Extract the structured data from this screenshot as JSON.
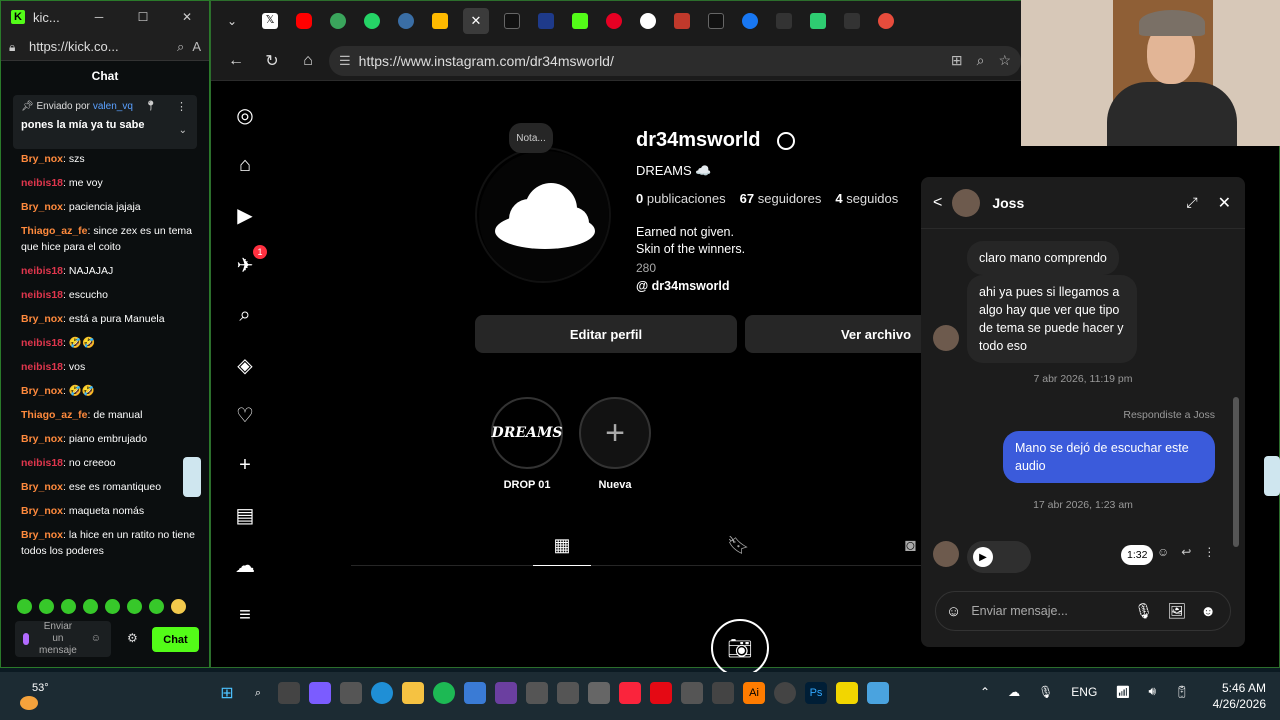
{
  "kick": {
    "title": "kic...",
    "url": "https://kick.co...",
    "chat_header": "Chat",
    "pinned": {
      "label": "Enviado por",
      "user": "valen_vq",
      "message": "pones la mía ya tu sabe"
    },
    "messages": [
      {
        "user": "Bry_nox",
        "text": ": szs",
        "color": "orange"
      },
      {
        "user": "neibis18",
        "text": ": me voy",
        "color": "red"
      },
      {
        "user": "Bry_nox",
        "text": ": paciencia jajaja",
        "color": "orange"
      },
      {
        "user": "Thiago_az_fe",
        "text": ": since zex es un tema que hice para el coito",
        "color": "orange"
      },
      {
        "user": "neibis18",
        "text": ": NAJAJAJ",
        "color": "red"
      },
      {
        "user": "neibis18",
        "text": ": escucho",
        "color": "red"
      },
      {
        "user": "Bry_nox",
        "text": ": está a pura Manuela",
        "color": "orange"
      },
      {
        "user": "neibis18",
        "text": ": 🤣🤣",
        "color": "red"
      },
      {
        "user": "neibis18",
        "text": ": vos",
        "color": "red"
      },
      {
        "user": "Bry_nox",
        "text": ": 🤣🤣",
        "color": "orange"
      },
      {
        "user": "Thiago_az_fe",
        "text": ": de manual",
        "color": "orange"
      },
      {
        "user": "Bry_nox",
        "text": ": piano embrujado",
        "color": "orange"
      },
      {
        "user": "neibis18",
        "text": ": no creeoo",
        "color": "red"
      },
      {
        "user": "Bry_nox",
        "text": ": ese es romantiqueo",
        "color": "orange"
      },
      {
        "user": "Bry_nox",
        "text": ": maqueta nomás",
        "color": "orange"
      },
      {
        "user": "Bry_nox",
        "text": ": la hice en un ratito no tiene todos los poderes",
        "color": "orange"
      }
    ],
    "input_placeholder": "Enviar un mensaje",
    "send_label": "Chat"
  },
  "browser": {
    "url": "https://www.instagram.com/dr34msworld/"
  },
  "profile": {
    "note": "Nota...",
    "username": "dr34msworld",
    "full_name": "DREAMS ☁️",
    "posts_count": "0",
    "posts_label": "publicaciones",
    "followers_count": "67",
    "followers_label": "seguidores",
    "following_count": "4",
    "following_label": "seguidos",
    "bio_line1": "Earned not given.",
    "bio_line2": "Skin of the winners.",
    "bio_number": "280",
    "threads": "dr34msworld",
    "edit_button": "Editar perfil",
    "archive_button": "Ver archivo",
    "highlights": [
      {
        "label": "DROP 01",
        "logo": "DREAMS"
      },
      {
        "label": "Nueva"
      }
    ],
    "notifications_badge": "1"
  },
  "dm": {
    "contact": "Joss",
    "messages_in": [
      "claro mano comprendo",
      "ahi ya pues si llegamos a algo hay que ver que tipo de tema se puede hacer y todo eso"
    ],
    "time1": "7 abr 2026, 11:19 pm",
    "replied_label": "Respondiste a Joss",
    "message_out": "Mano se dejó de escuchar este audio",
    "time2": "17 abr 2026, 1:23 am",
    "audio_duration": "1:32",
    "input_placeholder": "Enviar mensaje..."
  },
  "taskbar": {
    "temperature": "53°",
    "lang": "ENG",
    "time": "5:46 AM",
    "date": "4/26/2026"
  }
}
